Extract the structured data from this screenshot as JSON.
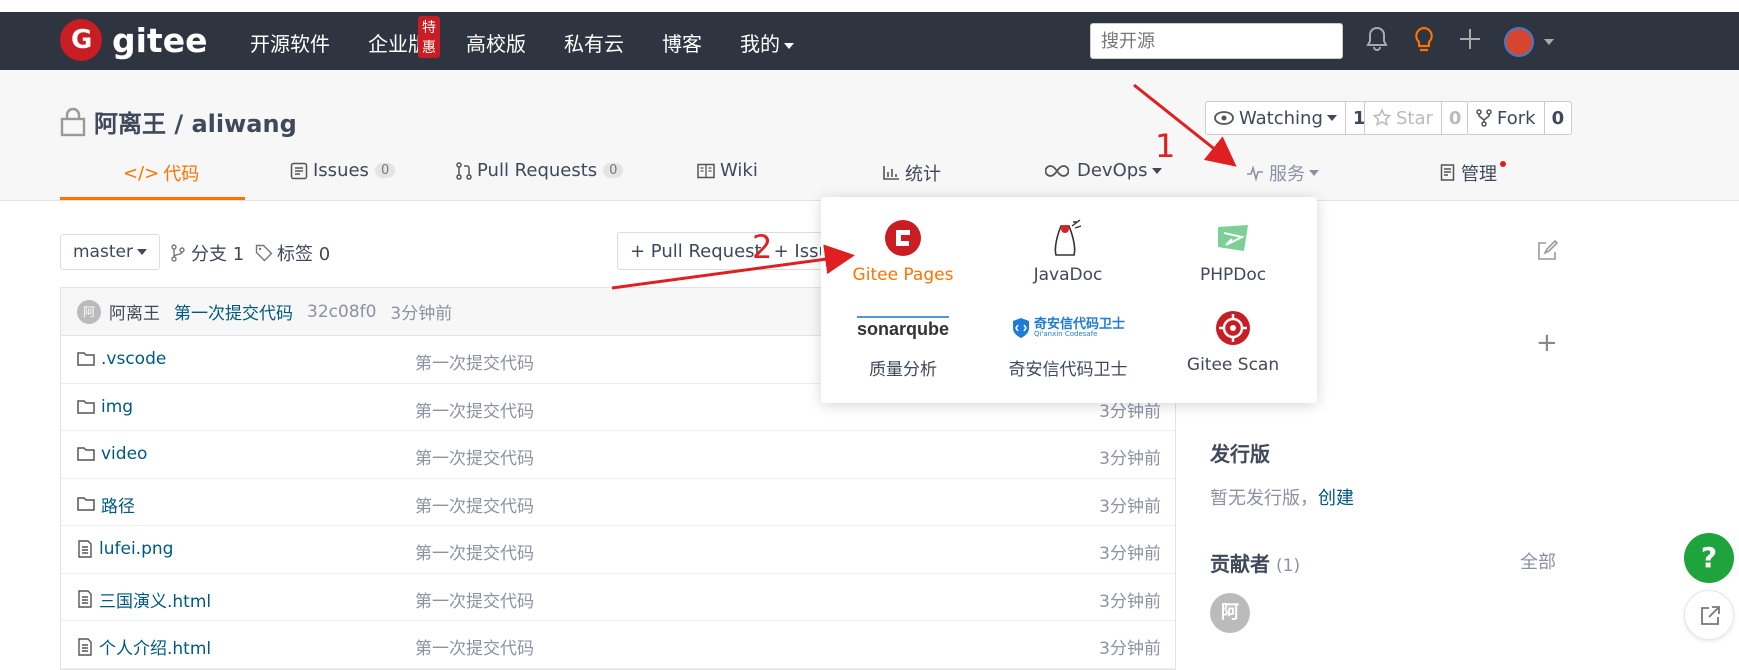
{
  "topnav": {
    "logo_text": "gitee",
    "items": [
      "开源软件",
      "企业版",
      "高校版",
      "私有云",
      "博客",
      "我的"
    ],
    "enterprise_badge": "特惠",
    "search_placeholder": "搜开源"
  },
  "repo": {
    "title": "阿离王 / aliwang",
    "watch": {
      "label": "Watching",
      "count": "1"
    },
    "star": {
      "label": "Star",
      "count": "0"
    },
    "fork": {
      "label": "Fork",
      "count": "0"
    }
  },
  "tabs": {
    "code": "代码",
    "issues": "Issues",
    "issues_count": "0",
    "pulls": "Pull Requests",
    "pulls_count": "0",
    "wiki": "Wiki",
    "stats": "统计",
    "devops": "DevOps",
    "services": "服务",
    "manage": "管理"
  },
  "toolbar": {
    "branch": "master",
    "branches": "分支 1",
    "tags": "标签 0",
    "pull_request": "+ Pull Request",
    "issue": "+ Issue"
  },
  "commit": {
    "avatar": "阿",
    "author": "阿离王",
    "message": "第一次提交代码",
    "hash": "32c08f0",
    "time": "3分钟前"
  },
  "files": [
    {
      "name": ".vscode",
      "type": "folder",
      "message": "第一次提交代码",
      "time": ""
    },
    {
      "name": "img",
      "type": "folder",
      "message": "第一次提交代码",
      "time": "3分钟前"
    },
    {
      "name": "video",
      "type": "folder",
      "message": "第一次提交代码",
      "time": "3分钟前"
    },
    {
      "name": "路径",
      "type": "folder",
      "message": "第一次提交代码",
      "time": "3分钟前"
    },
    {
      "name": "lufei.png",
      "type": "file",
      "message": "第一次提交代码",
      "time": "3分钟前"
    },
    {
      "name": "三国演义.html",
      "type": "file",
      "message": "第一次提交代码",
      "time": "3分钟前"
    },
    {
      "name": "个人介绍.html",
      "type": "file",
      "message": "第一次提交代码",
      "time": "3分钟前"
    }
  ],
  "sidebar": {
    "releases_title": "发行版",
    "releases_text": "暂无发行版，",
    "releases_create": "创建",
    "contributors_title": "贡献者",
    "contributors_count": "(1)",
    "contributors_all": "全部",
    "contributor_avatar": "阿"
  },
  "dropdown": {
    "items": [
      {
        "label": "Gitee Pages",
        "icon": "gitee-pages-icon"
      },
      {
        "label": "JavaDoc",
        "icon": "javadoc-icon"
      },
      {
        "label": "PHPDoc",
        "icon": "phpdoc-icon"
      },
      {
        "label": "质量分析",
        "icon": "sonarqube-icon",
        "logo_text": "sonarqube"
      },
      {
        "label": "奇安信代码卫士",
        "icon": "qianxin-icon",
        "logo_text": "奇安信代码卫士",
        "logo_subtext": "Qi'anxin Codesafe"
      },
      {
        "label": "Gitee Scan",
        "icon": "gitee-scan-icon"
      }
    ]
  },
  "annotations": {
    "step1": "1",
    "step2": "2"
  },
  "floating": {
    "help": "?"
  },
  "colors": {
    "topbar": "#2e3440",
    "accent": "#fe7300",
    "brand_red": "#c71d23",
    "annotation": "#e02020",
    "link": "#005980"
  }
}
